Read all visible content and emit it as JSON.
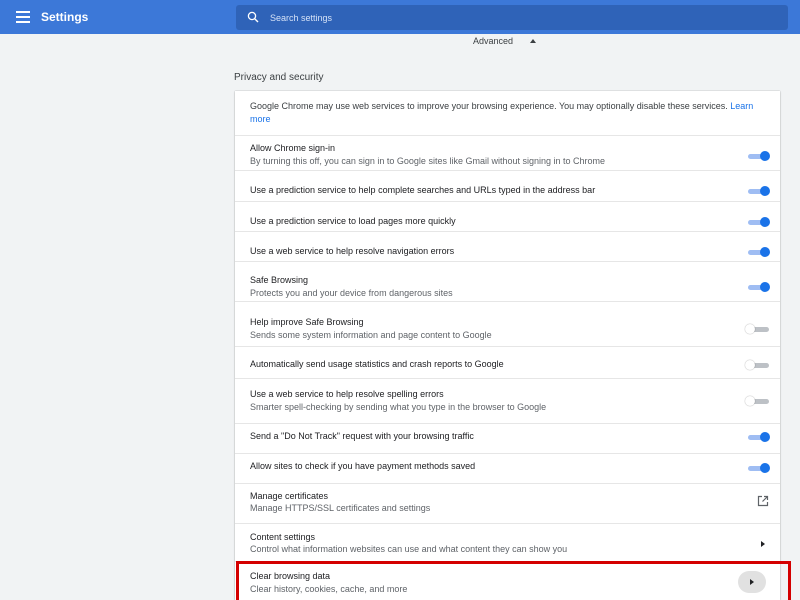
{
  "header": {
    "title": "Settings"
  },
  "search": {
    "placeholder": "Search settings"
  },
  "advanced": {
    "label": "Advanced"
  },
  "section": {
    "title": "Privacy and security"
  },
  "intro": {
    "text": "Google Chrome may use web services to improve your browsing experience. You may optionally disable these services.",
    "link": "Learn more"
  },
  "rows": [
    {
      "primary": "Allow Chrome sign-in",
      "secondary": "By turning this off, you can sign in to Google sites like Gmail without signing in to Chrome",
      "control": "toggle",
      "state": "on"
    },
    {
      "primary": "Use a prediction service to help complete searches and URLs typed in the address bar",
      "control": "toggle",
      "state": "on"
    },
    {
      "primary": "Use a prediction service to load pages more quickly",
      "control": "toggle",
      "state": "on"
    },
    {
      "primary": "Use a web service to help resolve navigation errors",
      "control": "toggle",
      "state": "on"
    },
    {
      "primary": "Safe Browsing",
      "secondary": "Protects you and your device from dangerous sites",
      "control": "toggle",
      "state": "on"
    },
    {
      "primary": "Help improve Safe Browsing",
      "secondary": "Sends some system information and page content to Google",
      "control": "toggle",
      "state": "off"
    },
    {
      "primary": "Automatically send usage statistics and crash reports to Google",
      "control": "toggle",
      "state": "off"
    },
    {
      "primary": "Use a web service to help resolve spelling errors",
      "secondary": "Smarter spell-checking by sending what you type in the browser to Google",
      "control": "toggle",
      "state": "off"
    },
    {
      "primary": "Send a \"Do Not Track\" request with your browsing traffic",
      "control": "toggle",
      "state": "on"
    },
    {
      "primary": "Allow sites to check if you have payment methods saved",
      "control": "toggle",
      "state": "on"
    },
    {
      "primary": "Manage certificates",
      "secondary": "Manage HTTPS/SSL certificates and settings",
      "control": "open-in-new-icon"
    },
    {
      "primary": "Content settings",
      "secondary": "Control what information websites can use and what content they can show you",
      "control": "arrow-right-icon"
    },
    {
      "primary": "Clear browsing data",
      "secondary": "Clear history, cookies, cache, and more",
      "control": "arrow-right-icon",
      "highlighted": true
    }
  ],
  "colors": {
    "header": "#3c78d8",
    "toggle_on": "#1a73e8",
    "highlight": "#d40000",
    "link": "#1a73e8"
  }
}
